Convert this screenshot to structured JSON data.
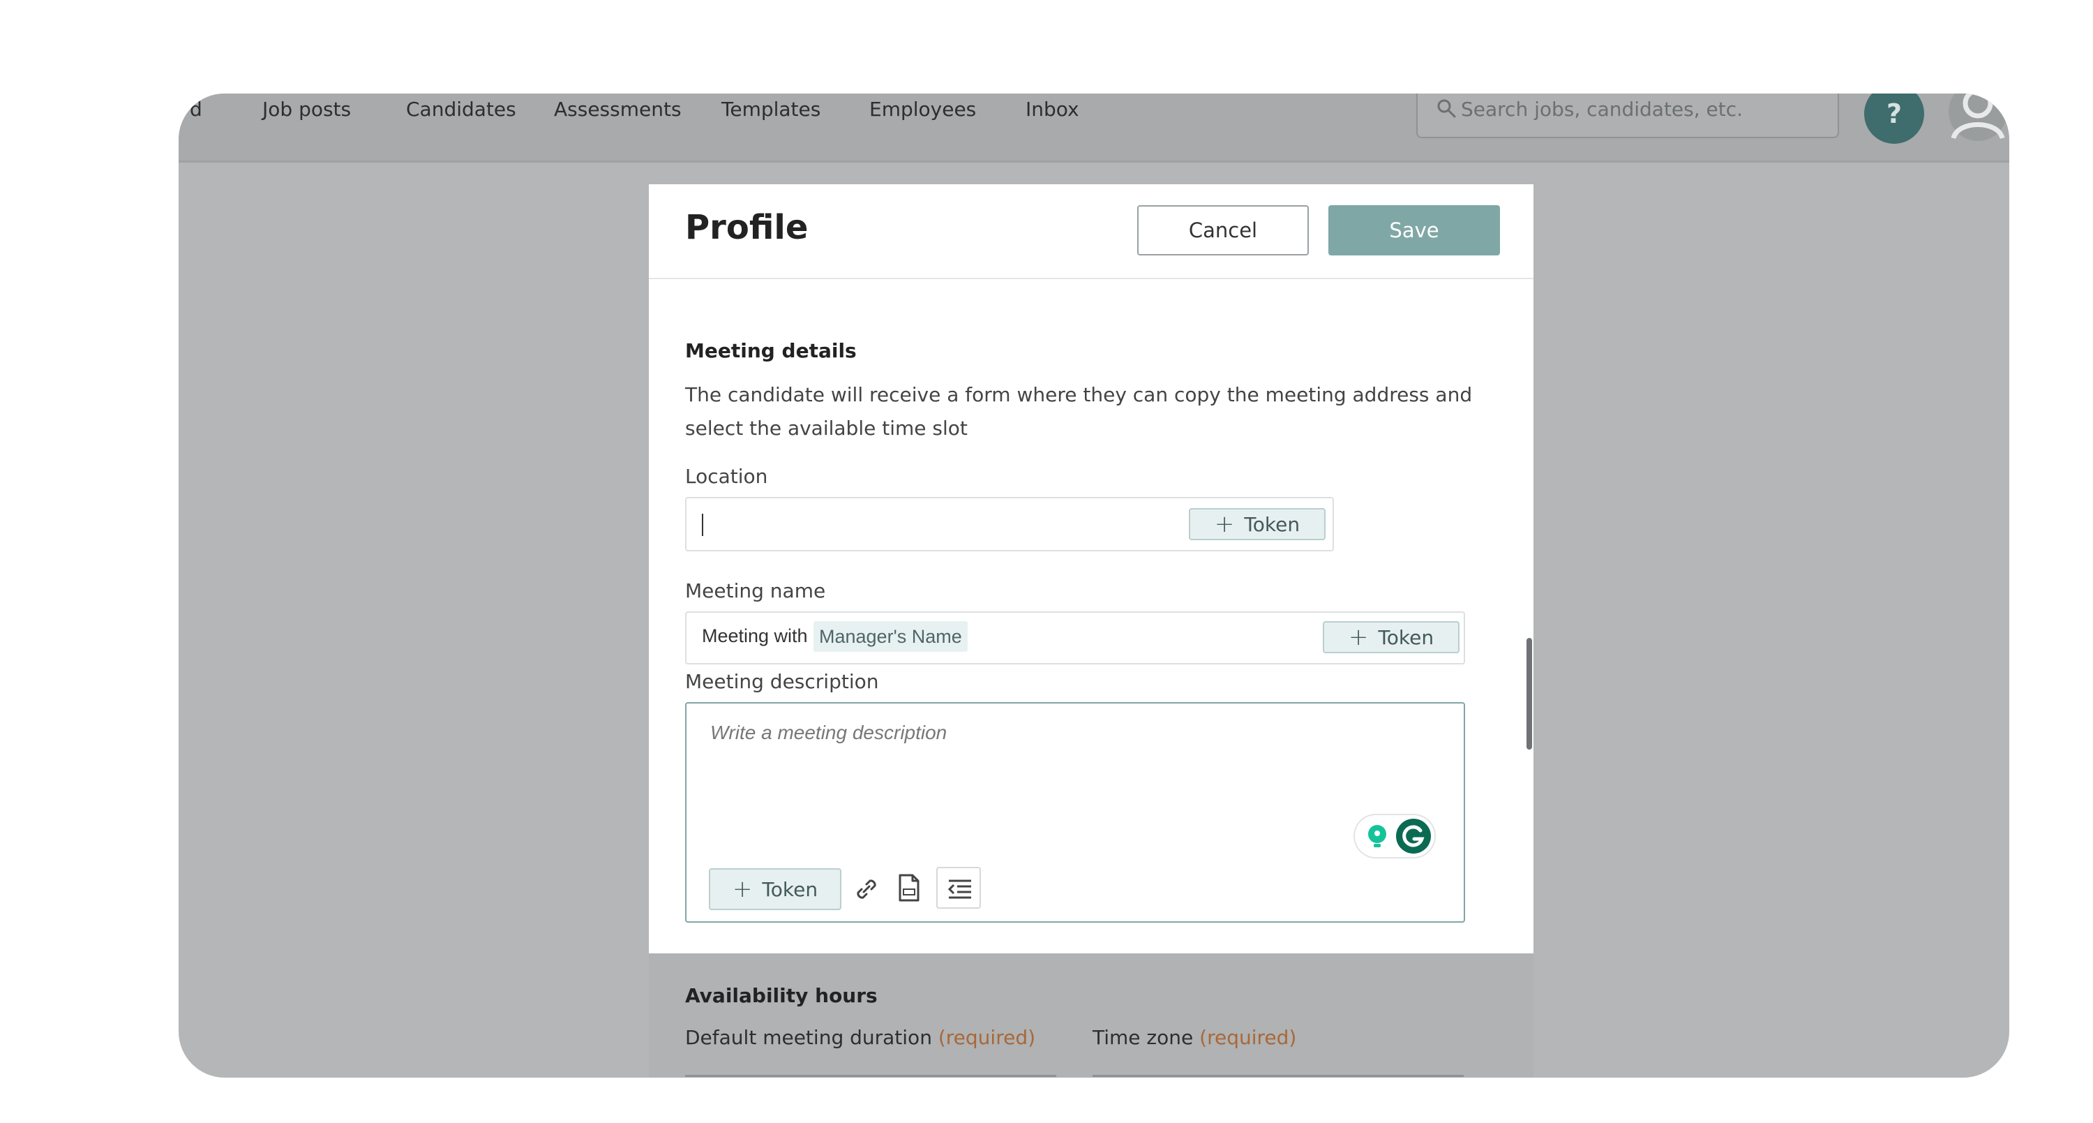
{
  "nav": {
    "items": [
      "d",
      "Job posts",
      "Candidates",
      "Assessments",
      "Templates",
      "Employees",
      "Inbox"
    ],
    "search_placeholder": "Search jobs, candidates, etc.",
    "help_label": "?"
  },
  "modal": {
    "title": "Profile",
    "cancel_label": "Cancel",
    "save_label": "Save"
  },
  "meeting": {
    "section_title": "Meeting details",
    "description": "The candidate will receive a form where they can copy the meeting address and select the available time slot",
    "location_label": "Location",
    "location_value": "",
    "token_label": "Token",
    "name_label": "Meeting name",
    "name_prefix": "Meeting with",
    "name_token": "Manager's Name",
    "description_label": "Meeting description",
    "description_placeholder": "Write a meeting description"
  },
  "availability": {
    "section_title": "Availability hours",
    "duration_label": "Default meeting duration",
    "timezone_label": "Time zone",
    "required_label": "(required)"
  },
  "colors": {
    "accent": "#7fa7a6",
    "help_bg": "#3f6c6c",
    "required": "#a8683a",
    "grammarly": "#15c39a"
  }
}
